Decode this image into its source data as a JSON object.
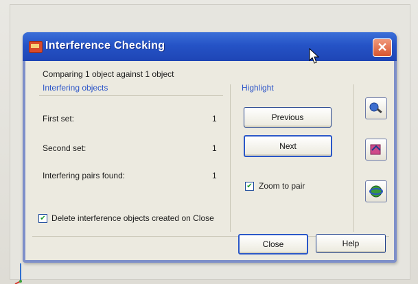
{
  "dialog": {
    "title": "Interference Checking",
    "summary": "Comparing 1 object against 1 object",
    "interfering_group": {
      "label": "Interfering objects",
      "rows": [
        {
          "label": "First set:",
          "value": "1"
        },
        {
          "label": "Second set:",
          "value": "1"
        },
        {
          "label": "Interfering pairs found:",
          "value": "1"
        }
      ]
    },
    "highlight_group": {
      "label": "Highlight",
      "previous_label": "Previous",
      "next_label": "Next",
      "zoom_label": "Zoom to pair",
      "zoom_checked": true
    },
    "delete_label": "Delete interference objects created on Close",
    "delete_checked": true,
    "close_label": "Close",
    "help_label": "Help"
  },
  "icons": [
    "dialog-app-icon",
    "close-icon",
    "zoom-realtime-icon",
    "pan-icon",
    "3d-orbit-icon",
    "mouse-cursor-icon",
    "ucs-axis-icon"
  ],
  "colors": {
    "titlebar": "#2553c6",
    "close": "#d8542e",
    "group_label": "#2c55c8",
    "dialog_bg": "#eceae0"
  }
}
